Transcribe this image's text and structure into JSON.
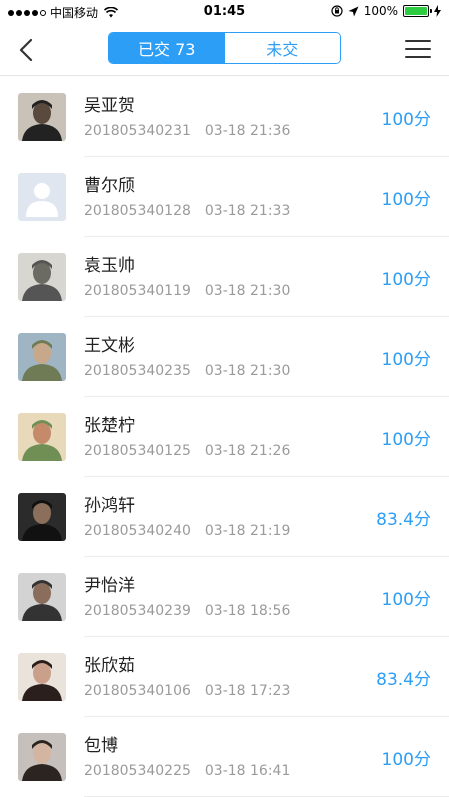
{
  "status_bar": {
    "carrier": "中国移动",
    "time": "01:45",
    "battery_percent": "100%"
  },
  "nav": {
    "tab_submitted": "已交 73",
    "tab_not_submitted": "未交"
  },
  "colors": {
    "accent": "#2d9ef5",
    "battery": "#2ecc40"
  },
  "students": [
    {
      "name": "吴亚贺",
      "id": "201805340231",
      "time": "03-18 21:36",
      "score": "100分",
      "avatar": "photo-dark-shirt"
    },
    {
      "name": "曹尔颀",
      "id": "201805340128",
      "time": "03-18 21:33",
      "score": "100分",
      "avatar": "default-placeholder"
    },
    {
      "name": "袁玉帅",
      "id": "201805340119",
      "time": "03-18 21:30",
      "score": "100分",
      "avatar": "photo-cap"
    },
    {
      "name": "王文彬",
      "id": "201805340235",
      "time": "03-18 21:30",
      "score": "100分",
      "avatar": "photo-outdoor"
    },
    {
      "name": "张楚柠",
      "id": "201805340125",
      "time": "03-18 21:26",
      "score": "100分",
      "avatar": "photo-room"
    },
    {
      "name": "孙鸿轩",
      "id": "201805340240",
      "time": "03-18 21:19",
      "score": "83.4分",
      "avatar": "photo-dark"
    },
    {
      "name": "尹怡洋",
      "id": "201805340239",
      "time": "03-18 18:56",
      "score": "100分",
      "avatar": "photo-glasses"
    },
    {
      "name": "张欣茹",
      "id": "201805340106",
      "time": "03-18 17:23",
      "score": "83.4分",
      "avatar": "photo-girl"
    },
    {
      "name": "包博",
      "id": "201805340225",
      "time": "03-18 16:41",
      "score": "100分",
      "avatar": "photo-longhair"
    }
  ]
}
